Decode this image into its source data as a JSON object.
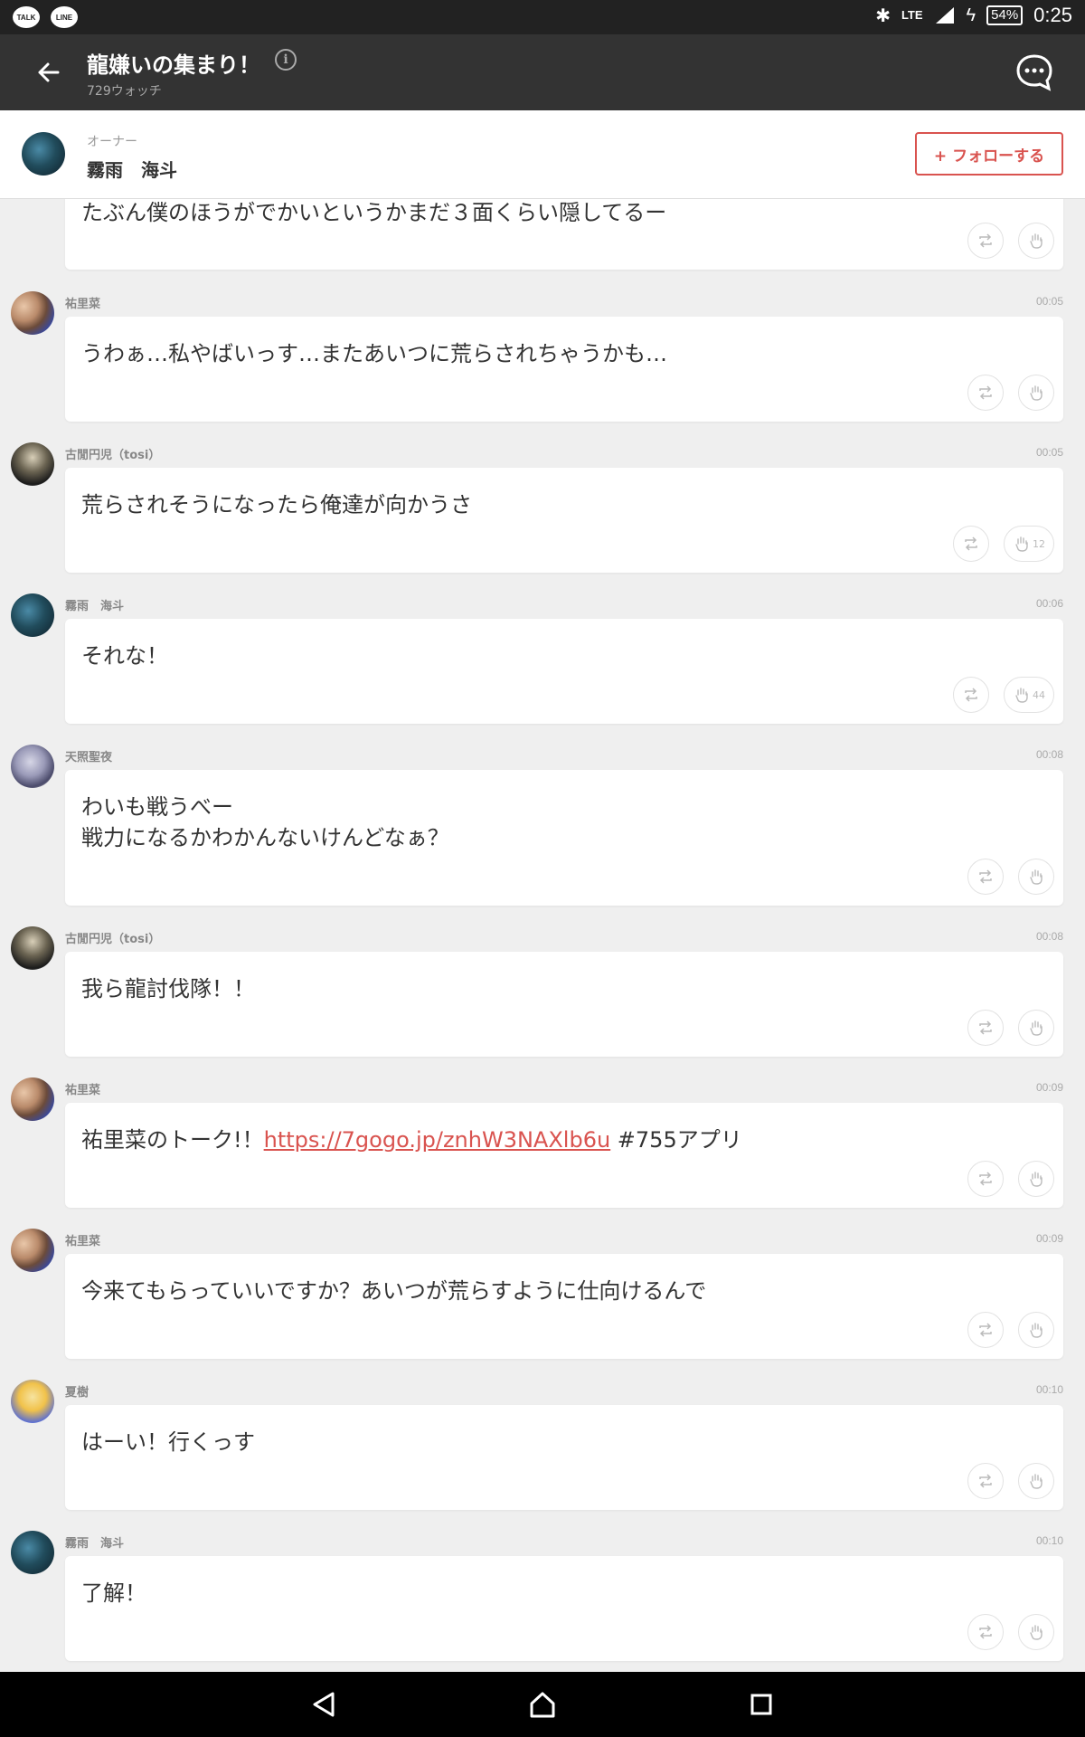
{
  "status_bar": {
    "left_icons": [
      "TALK",
      "LINE"
    ],
    "network": "LTE",
    "battery": "54%",
    "time": "0:25"
  },
  "app_bar": {
    "title": "龍嫌いの集まり！",
    "watch_count": "729ウォッチ",
    "info_icon": "i"
  },
  "owner": {
    "label": "オーナー",
    "name": "霧雨　海斗",
    "follow_label": "+ フォローする"
  },
  "posts": [
    {
      "name": "",
      "time": "",
      "text": "たぶん僕のほうがでかいというかまだ３面くらい隠してるー",
      "retweet": "",
      "claps": ""
    },
    {
      "name": "祐里菜",
      "time": "00:05",
      "text": "うわぁ…私やばいっす…またあいつに荒らされちゃうかも…",
      "retweet": "",
      "claps": ""
    },
    {
      "name": "古閒円児（tosi）",
      "time": "00:05",
      "text": "荒らされそうになったら俺達が向かうさ",
      "retweet": "",
      "claps": "12"
    },
    {
      "name": "霧雨　海斗",
      "time": "00:06",
      "text": "それな！",
      "retweet": "",
      "claps": "44"
    },
    {
      "name": "天照聖夜",
      "time": "00:08",
      "text": "わいも戦うべー\n戦力になるかわかんないけんどなぁ？",
      "retweet": "",
      "claps": ""
    },
    {
      "name": "古閒円児（tosi）",
      "time": "00:08",
      "text": "我ら龍討伐隊！！",
      "retweet": "",
      "claps": ""
    },
    {
      "name": "祐里菜",
      "time": "00:09",
      "text_prefix": "祐里菜のトーク!！",
      "link": "https://7gogo.jp/znhW3NAXlb6u",
      "text_suffix": " #755アプリ",
      "retweet": "",
      "claps": ""
    },
    {
      "name": "祐里菜",
      "time": "00:09",
      "text": "今来てもらっていいですか？あいつが荒らすように仕向けるんで",
      "retweet": "",
      "claps": ""
    },
    {
      "name": "夏樹",
      "time": "00:10",
      "text": "はーい！行くっす",
      "retweet": "",
      "claps": ""
    },
    {
      "name": "霧雨　海斗",
      "time": "00:10",
      "text": "了解！",
      "retweet": "",
      "claps": ""
    }
  ],
  "icons": {
    "back": "arrow-left-icon",
    "chat": "chat-bubble-icon",
    "retweet": "repost-icon",
    "clap": "clap-hand-icon",
    "nav_back": "triangle-back-icon",
    "nav_home": "home-icon",
    "nav_recent": "square-recent-icon"
  },
  "colors": {
    "accent": "#d9534f",
    "appbar": "#333333",
    "feed_bg": "#efefef"
  }
}
